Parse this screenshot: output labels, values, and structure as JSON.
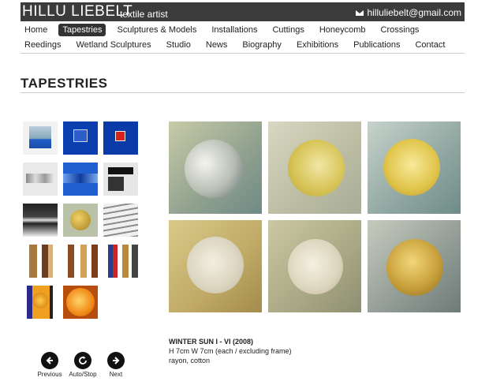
{
  "header": {
    "brand": "HILLU LIEBELT",
    "tagline": "textile artist",
    "email": "hilluliebelt@gmail.com"
  },
  "nav": {
    "row1": [
      "Home",
      "Tapestries",
      "Sculptures & Models",
      "Installations",
      "Cuttings",
      "Honeycomb",
      "Crossings"
    ],
    "row2": [
      "Reedings",
      "Wetland Sculptures",
      "Studio",
      "News",
      "Biography",
      "Exhibitions",
      "Publications",
      "Contact"
    ],
    "active": "Tapestries"
  },
  "page_title": "TAPESTRIES",
  "caption": {
    "title": "WINTER SUN I - VI (2008)",
    "dimensions": "H 7cm W 7cm (each / excluding frame)",
    "material": "rayon, cotton"
  },
  "controls": {
    "previous": "Previous",
    "autostop": "Auto/Stop",
    "next": "Next"
  },
  "colors": {
    "topbar": "#3b3b3b",
    "active_nav": "#333333"
  },
  "icons": [
    "mail-icon",
    "arrow-left-icon",
    "refresh-icon",
    "arrow-right-icon"
  ]
}
